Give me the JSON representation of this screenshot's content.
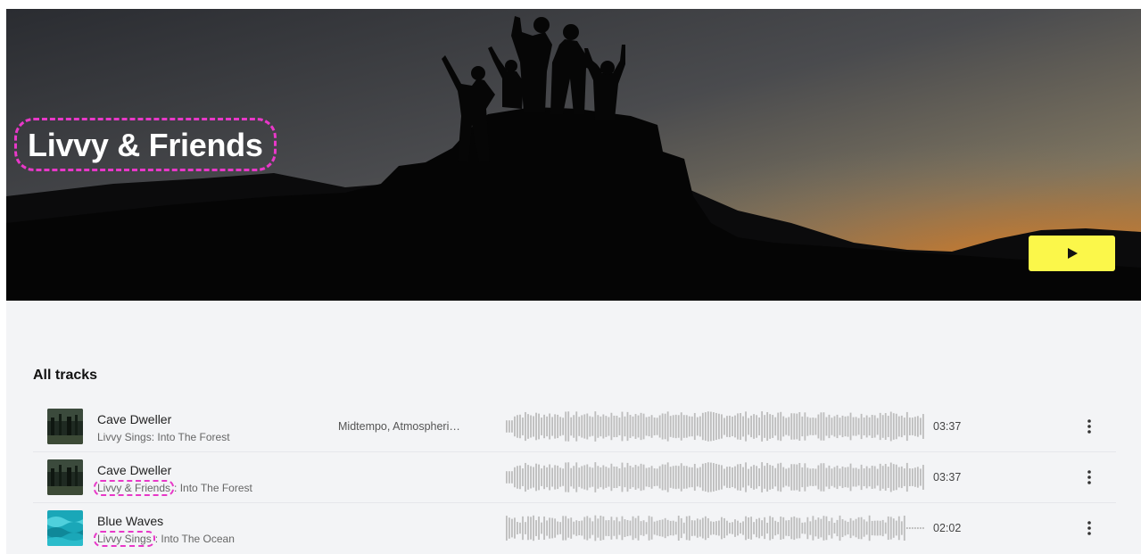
{
  "hero": {
    "title": "Livvy & Friends",
    "play_icon": "play-icon",
    "play_button_color": "#fbf74a"
  },
  "section": {
    "title": "All tracks"
  },
  "colors": {
    "highlight": "#e838c8",
    "background": "#f3f4f6"
  },
  "tracks": [
    {
      "title": "Cave Dweller",
      "artist": "Livvy Sings",
      "album": "Into The Forest",
      "separator": ": ",
      "tags": "Midtempo, Atmospheri…",
      "duration": "03:37",
      "thumb": "forest",
      "highlight_artist": false
    },
    {
      "title": "Cave Dweller",
      "artist": "Livvy & Friends",
      "album": "Into The Forest",
      "separator": ": ",
      "tags": "",
      "duration": "03:37",
      "thumb": "forest",
      "highlight_artist": true
    },
    {
      "title": "Blue Waves",
      "artist": "Livvy Sings",
      "album": "Into The Ocean",
      "separator": ": ",
      "tags": "",
      "duration": "02:02",
      "thumb": "ocean",
      "highlight_artist": true
    }
  ]
}
